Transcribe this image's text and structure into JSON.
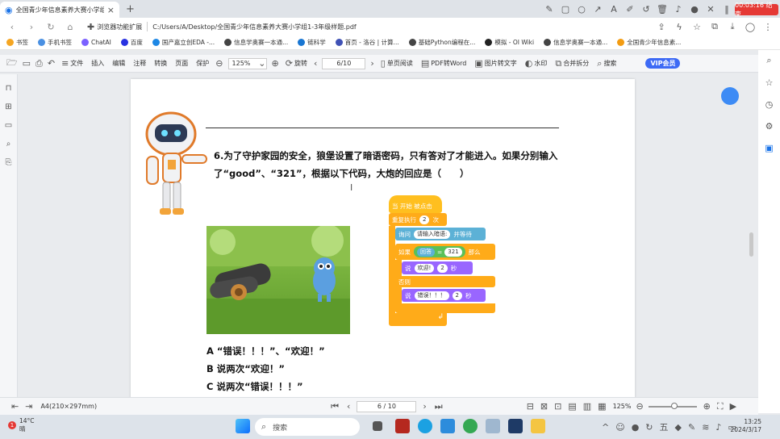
{
  "browser": {
    "tab_title": "全国青少年信息素养大赛小学组1",
    "timer": "00:03:16 结束",
    "ext_label": "浏览器功能扩展",
    "url": "C:/Users/A/Desktop/全国青少年信息素养大赛小学组1-3年级样题.pdf"
  },
  "bookmarks": [
    {
      "label": "书签",
      "color": "#f5a623"
    },
    {
      "label": "手机书签",
      "color": "#4a90e2"
    },
    {
      "label": "ChatAI",
      "color": "#7b61ff"
    },
    {
      "label": "百度",
      "color": "#2932e1"
    },
    {
      "label": "国产嘉立创EDA -...",
      "color": "#1e88e5"
    },
    {
      "label": "信息学奥赛一本通...",
      "color": "#444444"
    },
    {
      "label": "链科学",
      "color": "#1976d2"
    },
    {
      "label": "首页 - 洛谷 | 计算...",
      "color": "#3f51b5"
    },
    {
      "label": "基础Python编程在...",
      "color": "#444444"
    },
    {
      "label": "模拟 - OI Wiki",
      "color": "#222222"
    },
    {
      "label": "信息学奥赛一本通...",
      "color": "#444444"
    },
    {
      "label": "全国青少年信息素...",
      "color": "#f39c12"
    }
  ],
  "toolbar": {
    "file": "文件",
    "insert": "插入",
    "edit": "编辑",
    "annotate": "注释",
    "convert": "转换",
    "page": "页面",
    "protect": "保护",
    "zoom": "125%",
    "rotate": "旋转",
    "page_nav": "6/10",
    "single_page": "单页阅读",
    "pdf2word": "PDF转Word",
    "img2text": "图片转文字",
    "watermark": "水印",
    "merge": "合并拆分",
    "search": "搜索",
    "vip": "VIP会员"
  },
  "document": {
    "question": "6.为了守护家园的安全，狼堡设置了暗语密码，只有答对了才能进入。如果分别输入了“good”、“321”，根据以下代码，大炮的回应是（　　）",
    "options": [
      "A “错误！！！”、“欢迎！”",
      "B 说两次“欢迎！”",
      "C 说两次“错误！！！”"
    ]
  },
  "scratch": {
    "hat": "当 开始 被点击",
    "repeat": "重复执行",
    "repeat_n": "2",
    "repeat_unit": "次",
    "ask": "询问",
    "ask_text": "请输入暗语:",
    "ask_wait": "并等待",
    "if": "如果",
    "answer": "回答",
    "eq": "=",
    "value": "321",
    "then": "那么",
    "say": "说",
    "say1": "欢迎!",
    "say1_n": "2",
    "sec": "秒",
    "else": "否则",
    "say2": "错误！！！",
    "say2_n": "2"
  },
  "status": {
    "paper": "A4(210×297mm)",
    "page": "6 / 10",
    "zoom": "125%"
  },
  "taskbar": {
    "temp": "14°C",
    "weather": "晴",
    "badge": "1",
    "search": "搜索",
    "time": "13:25",
    "date": "2024/3/17"
  }
}
